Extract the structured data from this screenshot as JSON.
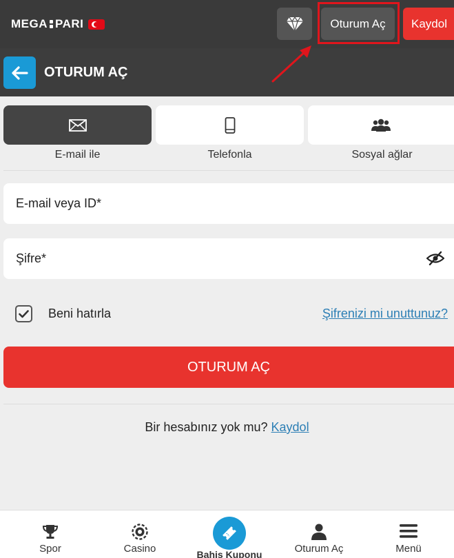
{
  "header": {
    "logo_left": "MEGA",
    "logo_right": "PARI",
    "flag_icon": "turkey-flag-icon",
    "gem_icon": "diamond-icon",
    "login_label": "Oturum Aç",
    "register_label": "Kaydol",
    "accent_red": "#e8332e",
    "accent_blue": "#1a9ad6"
  },
  "titlebar": {
    "back_icon": "arrow-left-icon",
    "title": "OTURUM AÇ"
  },
  "tabs": [
    {
      "label": "E-mail ile",
      "icon": "envelope-icon",
      "active": true
    },
    {
      "label": "Telefonla",
      "icon": "mobile-phone-icon",
      "active": false
    },
    {
      "label": "Sosyal ağlar",
      "icon": "users-icon",
      "active": false
    }
  ],
  "form": {
    "email_placeholder": "E-mail veya ID*",
    "password_placeholder": "Şifre*",
    "eye_icon": "eye-slash-icon",
    "remember_label": "Beni hatırla",
    "remember_checked": true,
    "forgot_label": "Şifrenizi mi unuttunuz?",
    "submit_label": "OTURUM AÇ"
  },
  "signup": {
    "prompt": "Bir hesabınız yok mu?",
    "link": "Kaydol"
  },
  "bottom_nav": [
    {
      "label": "Spor",
      "icon": "trophy-icon"
    },
    {
      "label": "Casino",
      "icon": "casino-chip-icon"
    },
    {
      "label": "Bahis Kuponu",
      "icon": "ticket-icon"
    },
    {
      "label": "Oturum Aç",
      "icon": "user-icon"
    },
    {
      "label": "Menü",
      "icon": "hamburger-menu-icon"
    }
  ]
}
